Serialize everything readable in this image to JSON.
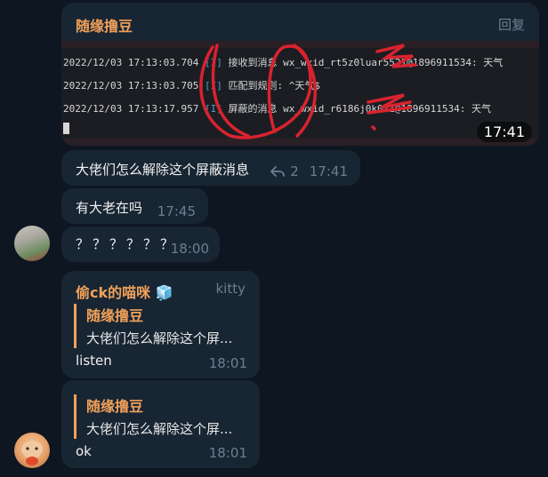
{
  "messages": {
    "m1": {
      "sender": "随缘撸豆",
      "reply_label": "回复",
      "log_lines": [
        {
          "ts": "2022/12/03 17:13:03.704",
          "lvl": "[I]",
          "msg": "接收到消息 wx_wxid_rt5z0luar5521@1896911534: 天气"
        },
        {
          "ts": "2022/12/03 17:13:03.705",
          "lvl": "[I]",
          "msg": "匹配到规则: ^天气$"
        },
        {
          "ts": "2022/12/03 17:13:17.957",
          "lvl": "[I]",
          "msg": "屏蔽的消息 wx_wxid_r6186j0k011@1896911534: 天气"
        }
      ],
      "time": "17:41"
    },
    "m2": {
      "text": "大佬们怎么解除这个屏蔽消息",
      "reply_count": "2",
      "time": "17:41"
    },
    "m3": {
      "text": "有大老在吗",
      "time": "17:45"
    },
    "m4": {
      "text": "？？？？？？",
      "time": "18:00"
    },
    "m5": {
      "sender": "偷ck的喵咪",
      "sender_badge": "🧊",
      "tag": "kitty",
      "quote_name": "随缘撸豆",
      "quote_text": "大佬们怎么解除这个屏...",
      "text": "listen",
      "time": "18:01"
    },
    "m6": {
      "quote_name": "随缘撸豆",
      "quote_text": "大佬们怎么解除这个屏...",
      "text": "ok",
      "time": "18:01"
    }
  },
  "colors": {
    "background": "#0e1621",
    "bubble": "#182533",
    "sender_name": "#f0a15a",
    "meta": "#6d7f8f",
    "scribble": "#d8232f"
  },
  "icons": {
    "reply": "reply-arrow-icon",
    "badge": "ice-cube-icon"
  }
}
